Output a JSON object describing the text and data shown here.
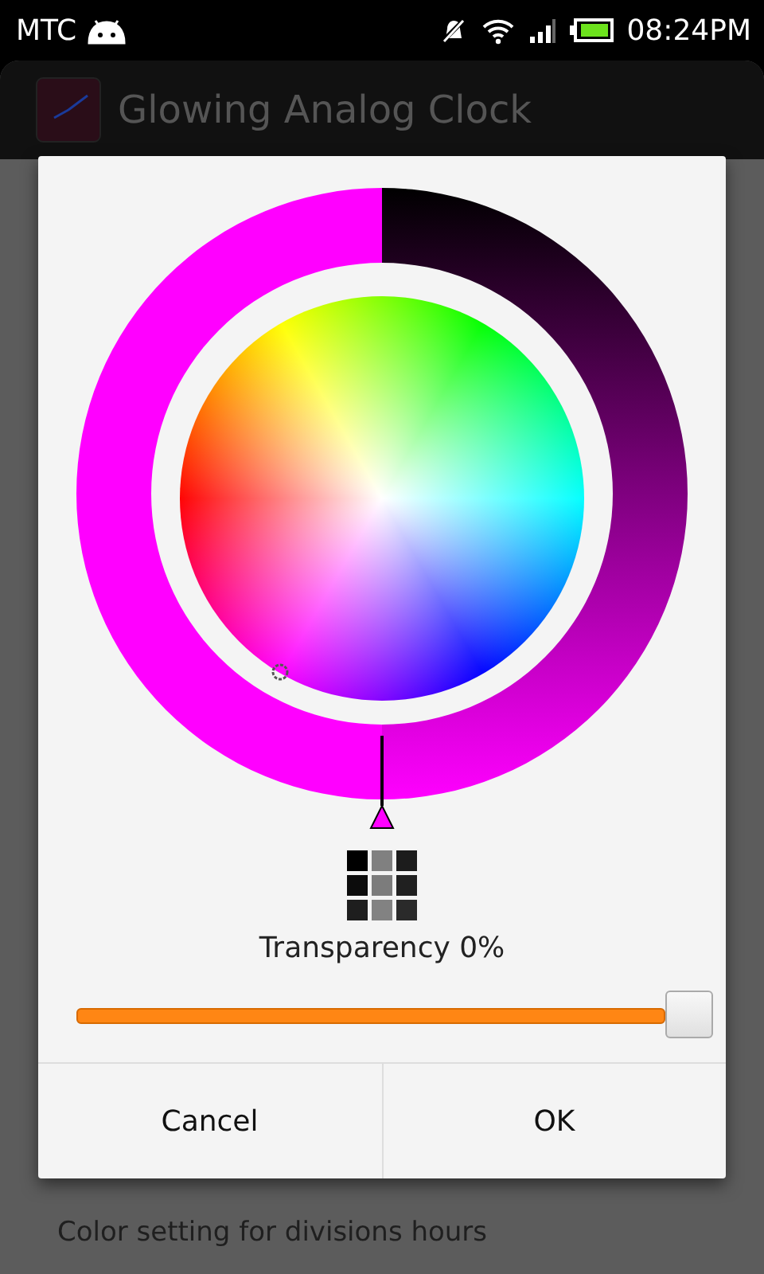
{
  "status_bar": {
    "carrier": "MTC",
    "time": "08:24PM"
  },
  "app_bar": {
    "title": "Glowing Analog Clock"
  },
  "setting": {
    "summary": "Color setting for divisions hours"
  },
  "dialog": {
    "transparency_label": "Transparency 0%",
    "slider": {
      "level": 1.0
    },
    "buttons": [
      "Cancel",
      "OK"
    ]
  }
}
